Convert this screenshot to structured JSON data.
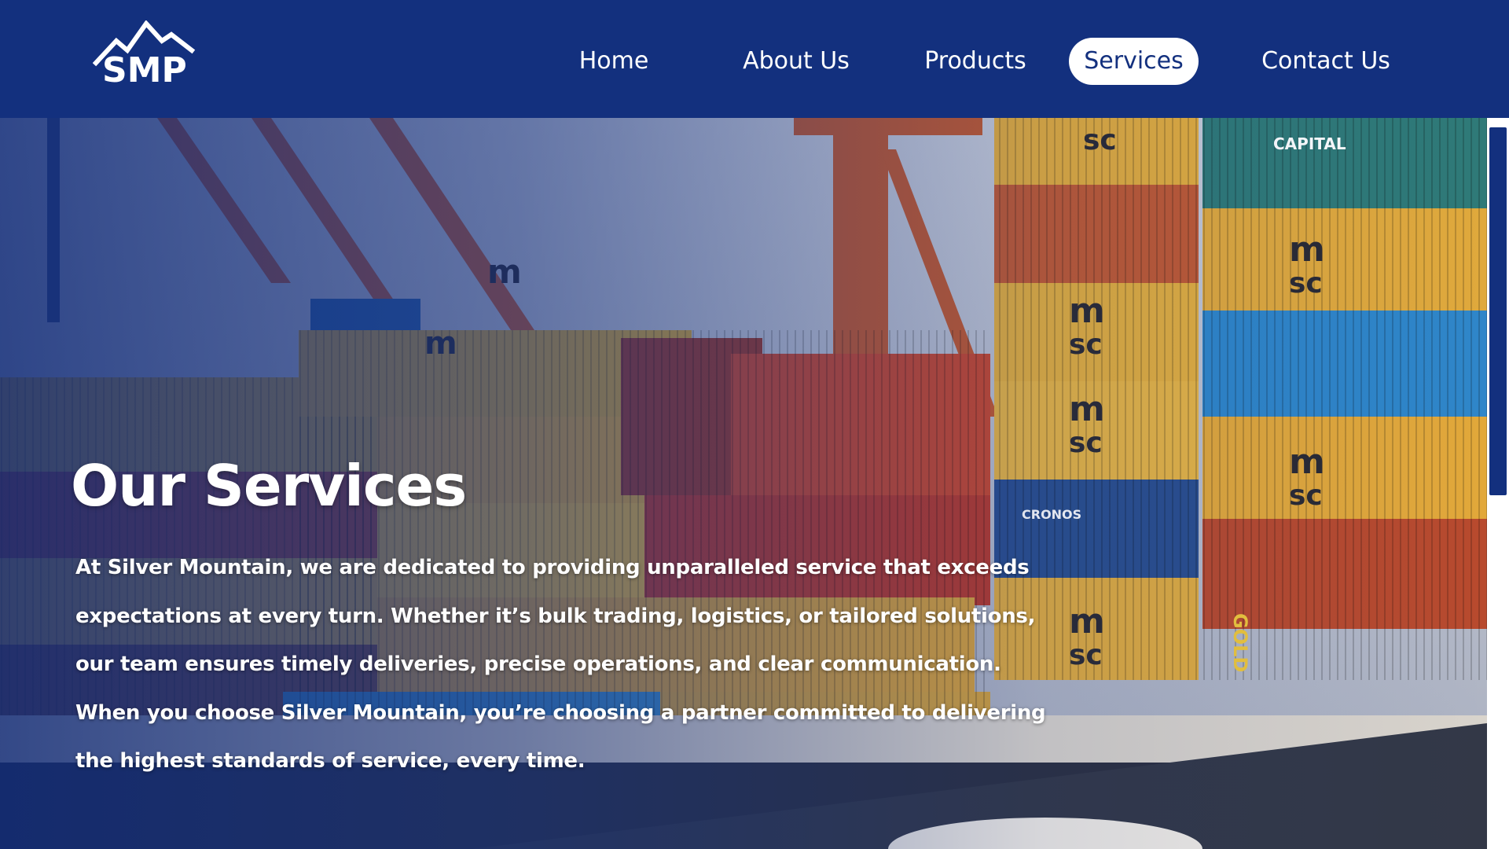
{
  "header": {
    "logo_text": "SMP",
    "nav": [
      {
        "label": "Home",
        "active": false
      },
      {
        "label": "About Us",
        "active": false
      },
      {
        "label": "Products",
        "active": false
      },
      {
        "label": "Services",
        "active": true
      },
      {
        "label": "Contact Us",
        "active": false
      }
    ]
  },
  "hero": {
    "title": "Our Services",
    "body_lines": [
      "At Silver Mountain, we are dedicated to providing unparalleled service that exceeds",
      "expectations at every turn. Whether it’s bulk trading, logistics, or tailored solutions,",
      "our team ensures timely deliveries, precise operations, and clear communication.",
      "When you choose Silver Mountain, you’re choosing a partner committed to delivering",
      "the highest standards of service, every time."
    ],
    "background_image": "shipping-containers-photo",
    "container_markings": [
      "msc",
      "CAPITAL",
      "CRONOS",
      "GOLD"
    ]
  },
  "colors": {
    "brand_navy": "#13307e",
    "nav_text": "#ffffff",
    "active_pill_bg": "#ffffff",
    "active_pill_text": "#13307e"
  }
}
